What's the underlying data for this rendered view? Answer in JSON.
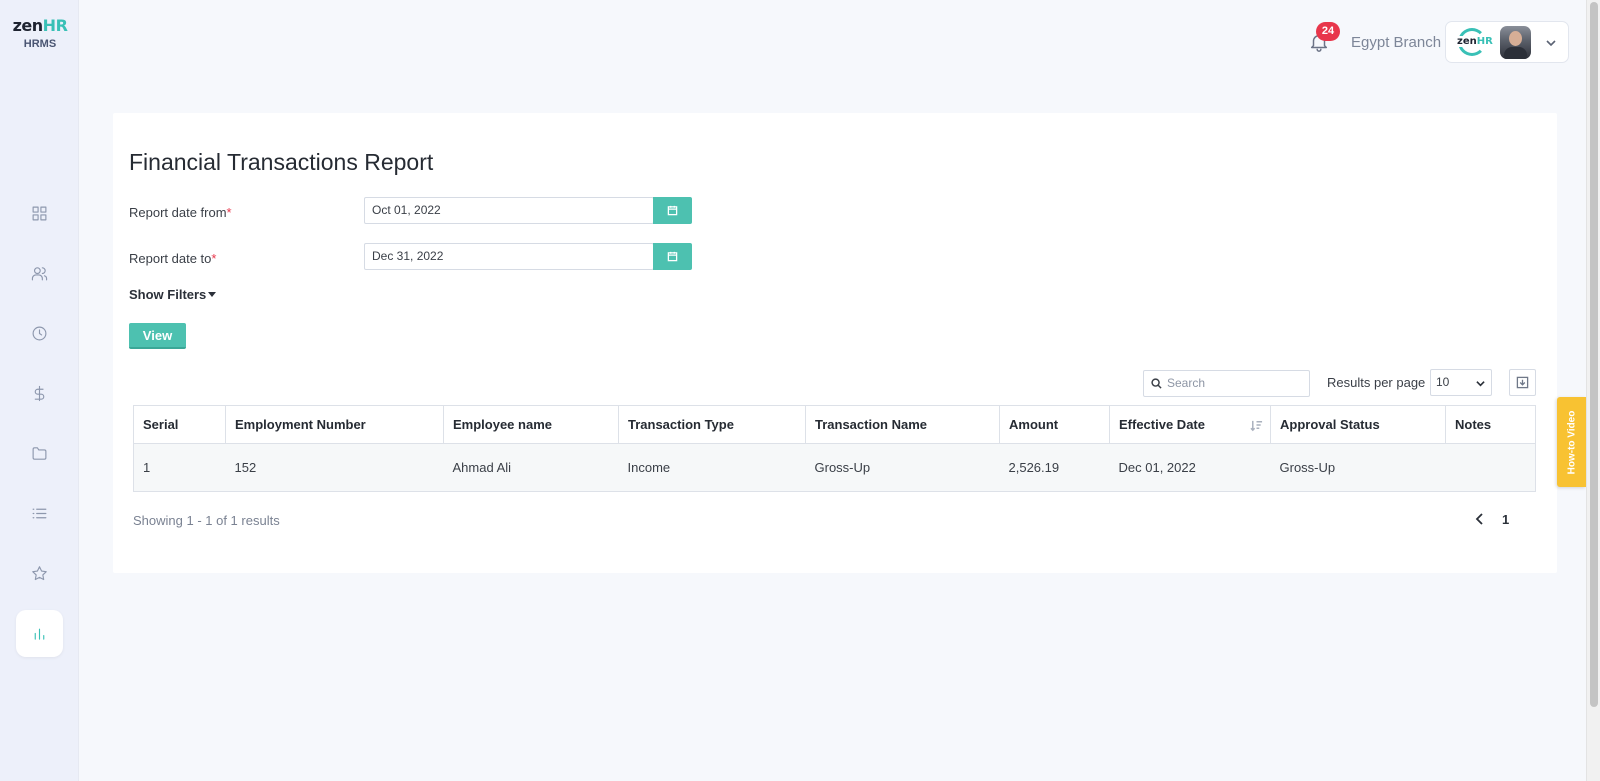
{
  "brand": {
    "logo_main": "zen",
    "logo_accent": "HR",
    "logo_sub": "HRMS",
    "accent_color": "#39c0b6"
  },
  "sidebar": {
    "items": [
      {
        "icon": "dashboard-icon"
      },
      {
        "icon": "users-icon"
      },
      {
        "icon": "clock-icon"
      },
      {
        "icon": "dollar-icon"
      },
      {
        "icon": "folder-icon"
      },
      {
        "icon": "list-icon"
      },
      {
        "icon": "star-icon"
      },
      {
        "icon": "bar-chart-icon",
        "active": true
      }
    ]
  },
  "header": {
    "notification_count": "24",
    "branch": "Egypt Branch",
    "mini_logo_main": "zen",
    "mini_logo_accent": "HR"
  },
  "report": {
    "title": "Financial Transactions Report",
    "date_from_label": "Report date from",
    "date_from_value": "Oct 01, 2022",
    "date_to_label": "Report date to",
    "date_to_value": "Dec 31, 2022",
    "required_mark": "*",
    "show_filters": "Show Filters",
    "view_button": "View"
  },
  "table_controls": {
    "search_placeholder": "Search",
    "results_per_page_label": "Results per page",
    "results_per_page_value": "10"
  },
  "table": {
    "headers": [
      "Serial",
      "Employment Number",
      "Employee name",
      "Transaction Type",
      "Transaction Name",
      "Amount",
      "Effective Date",
      "Approval Status",
      "Notes"
    ],
    "rows": [
      [
        "1",
        "152",
        "Ahmad Ali",
        "Income",
        "Gross-Up",
        "2,526.19",
        "Dec 01, 2022",
        "Gross-Up",
        ""
      ]
    ]
  },
  "pagination": {
    "showing": "Showing 1 - 1 of 1 results",
    "current_page": "1"
  },
  "howto": {
    "label": "How-to Video"
  }
}
